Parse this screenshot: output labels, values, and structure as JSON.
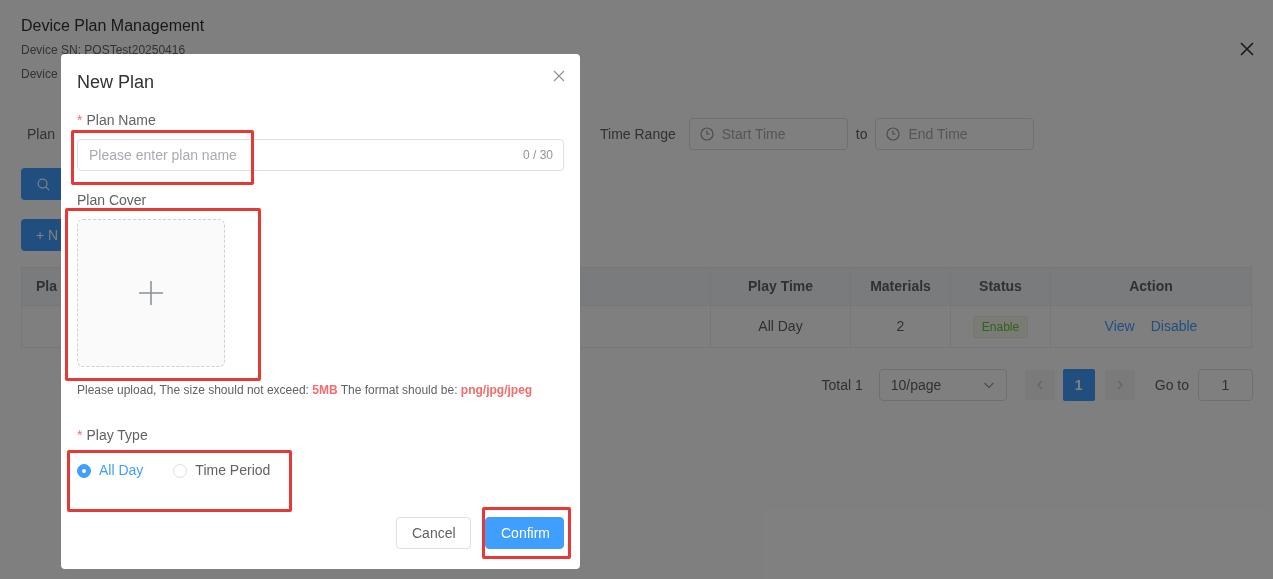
{
  "page": {
    "title": "Device Plan Management",
    "device_sn": "Device SN: POSTest20250416",
    "device_line_2": "Device"
  },
  "filters": {
    "plan_label": "Plan",
    "time_range_label": "Time Range",
    "start_placeholder": "Start Time",
    "to": "to",
    "end_placeholder": "End Time"
  },
  "buttons": {
    "new": "+ N"
  },
  "table": {
    "columns": [
      "Pla",
      "Play Time",
      "Materials",
      "Status",
      "Action"
    ],
    "rows": [
      {
        "play_time": "All Day",
        "materials": "2",
        "status": "Enable",
        "actions": [
          "View",
          "Disable"
        ]
      }
    ]
  },
  "pagination": {
    "total": "Total 1",
    "page_size": "10/page",
    "pages": [
      {
        "label": "1",
        "selected": true
      }
    ],
    "goto_label": "Go to",
    "goto_value": "1"
  },
  "dialog": {
    "title": "New Plan",
    "plan_name": {
      "label": "Plan Name",
      "required_mark": "*",
      "placeholder": "Please enter plan name",
      "counter": "0 / 30",
      "highlighted": true
    },
    "plan_cover": {
      "label": "Plan Cover",
      "highlighted": true,
      "hint": "Please upload, The size should not exceed: **5MB** The format should be: **png/jpg/jpeg**"
    },
    "play_type": {
      "label": "Play Type",
      "required_mark": "*",
      "highlighted": true,
      "options": [
        {
          "label": "All Day",
          "selected": true
        },
        {
          "label": "Time Period",
          "selected": false
        }
      ]
    },
    "buttons": [
      {
        "label": "Cancel",
        "kind": "secondary"
      },
      {
        "label": "Confirm",
        "kind": "primary",
        "highlighted": true
      }
    ]
  }
}
